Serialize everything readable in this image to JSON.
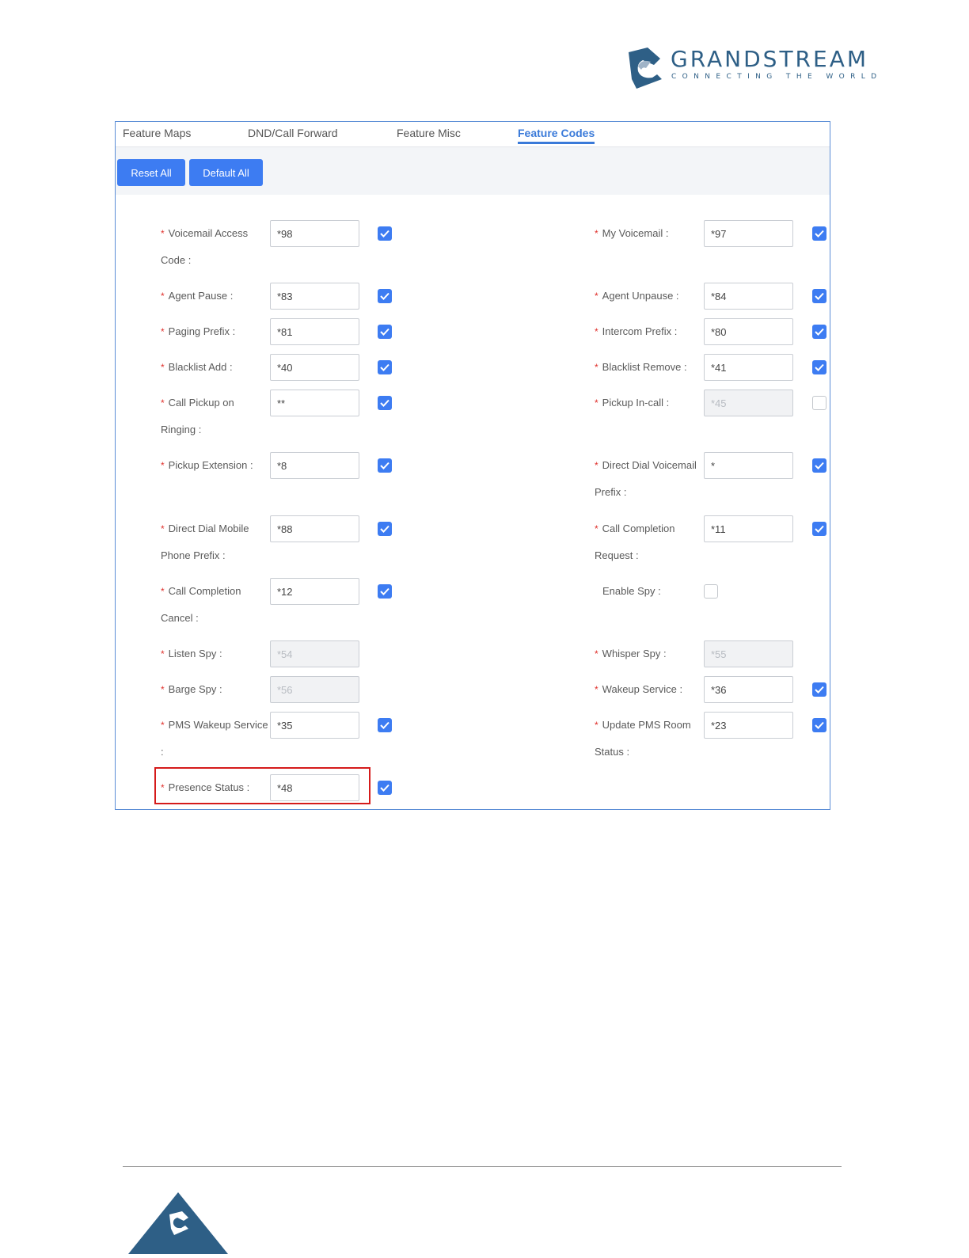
{
  "brand": {
    "name": "GRANDSTREAM",
    "tagline": "CONNECTING THE WORLD",
    "colors": {
      "primary": "#2e5f86",
      "accent": "#3d7cf2",
      "required": "#e0312c",
      "highlight": "#d51b1b"
    }
  },
  "tabs": [
    {
      "label": "Feature Maps",
      "active": false
    },
    {
      "label": "DND/Call Forward",
      "active": false
    },
    {
      "label": "Feature Misc",
      "active": false
    },
    {
      "label": "Feature Codes",
      "active": true
    }
  ],
  "toolbar": {
    "reset_all": "Reset All",
    "default_all": "Default All"
  },
  "fields_left": [
    {
      "label": "Voicemail Access Code :",
      "value": "*98",
      "enabled": true,
      "disabled_input": false
    },
    {
      "label": "Agent Pause :",
      "value": "*83",
      "enabled": true,
      "disabled_input": false
    },
    {
      "label": "Paging Prefix :",
      "value": "*81",
      "enabled": true,
      "disabled_input": false
    },
    {
      "label": "Blacklist Add :",
      "value": "*40",
      "enabled": true,
      "disabled_input": false
    },
    {
      "label": "Call Pickup on Ringing :",
      "value": "**",
      "enabled": true,
      "disabled_input": false
    },
    {
      "label": "Pickup Extension :",
      "value": "*8",
      "enabled": true,
      "disabled_input": false
    },
    {
      "label": "Direct Dial Mobile Phone Prefix :",
      "value": "*88",
      "enabled": true,
      "disabled_input": false
    },
    {
      "label": "Call Completion Cancel :",
      "value": "*12",
      "enabled": true,
      "disabled_input": false
    },
    {
      "label": "Listen Spy :",
      "value": "*54",
      "enabled": null,
      "disabled_input": true
    },
    {
      "label": "Barge Spy :",
      "value": "*56",
      "enabled": null,
      "disabled_input": true
    },
    {
      "label": "PMS Wakeup Service :",
      "value": "*35",
      "enabled": true,
      "disabled_input": false
    },
    {
      "label": "Presence Status :",
      "value": "*48",
      "enabled": true,
      "disabled_input": false
    }
  ],
  "fields_right": [
    {
      "label": "My Voicemail :",
      "value": "*97",
      "enabled": true,
      "disabled_input": false
    },
    {
      "label": "Agent Unpause :",
      "value": "*84",
      "enabled": true,
      "disabled_input": false
    },
    {
      "label": "Intercom Prefix :",
      "value": "*80",
      "enabled": true,
      "disabled_input": false
    },
    {
      "label": "Blacklist Remove :",
      "value": "*41",
      "enabled": true,
      "disabled_input": false
    },
    {
      "label": "Pickup In-call :",
      "value": "*45",
      "enabled": false,
      "disabled_input": true
    },
    {
      "label": "Direct Dial Voicemail Prefix :",
      "value": "*",
      "enabled": true,
      "disabled_input": false
    },
    {
      "label": "Call Completion Request :",
      "value": "*11",
      "enabled": true,
      "disabled_input": false
    },
    {
      "label": "Enable Spy :",
      "value": null,
      "enabled": false,
      "disabled_input": false,
      "checkbox_only": true,
      "required": false
    },
    {
      "label": "Whisper Spy :",
      "value": "*55",
      "enabled": null,
      "disabled_input": true
    },
    {
      "label": "Wakeup Service :",
      "value": "*36",
      "enabled": true,
      "disabled_input": false
    },
    {
      "label": "Update PMS Room Status :",
      "value": "*23",
      "enabled": true,
      "disabled_input": false
    }
  ]
}
